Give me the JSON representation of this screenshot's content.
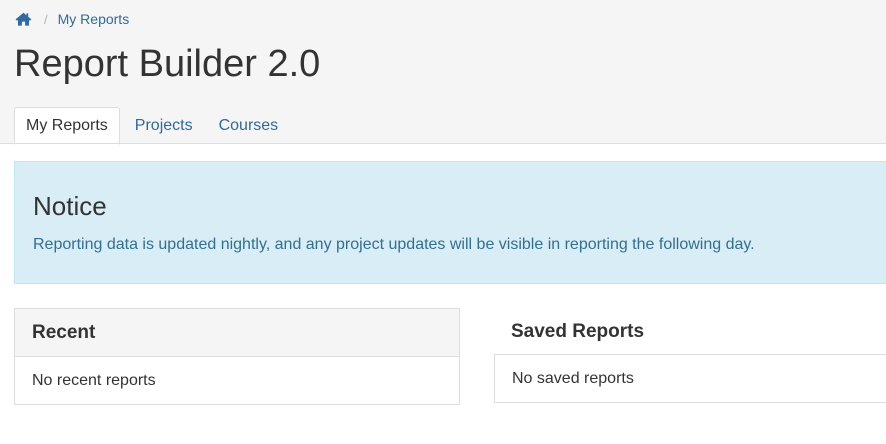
{
  "breadcrumb": {
    "home_icon": "home-icon",
    "items": [
      {
        "label": "My Reports"
      }
    ]
  },
  "page": {
    "title": "Report Builder 2.0"
  },
  "tabs": [
    {
      "label": "My Reports",
      "active": true
    },
    {
      "label": "Projects",
      "active": false
    },
    {
      "label": "Courses",
      "active": false
    }
  ],
  "notice": {
    "title": "Notice",
    "text": "Reporting data is updated nightly, and any project updates will be visible in reporting the following day."
  },
  "recent": {
    "heading": "Recent",
    "empty_text": "No recent reports"
  },
  "saved": {
    "heading": "Saved Reports",
    "empty_text": "No saved reports"
  },
  "colors": {
    "link": "#2f6aa0",
    "notice_bg": "#d9edf7",
    "notice_text": "#31708f",
    "header_bg": "#f5f5f5"
  }
}
